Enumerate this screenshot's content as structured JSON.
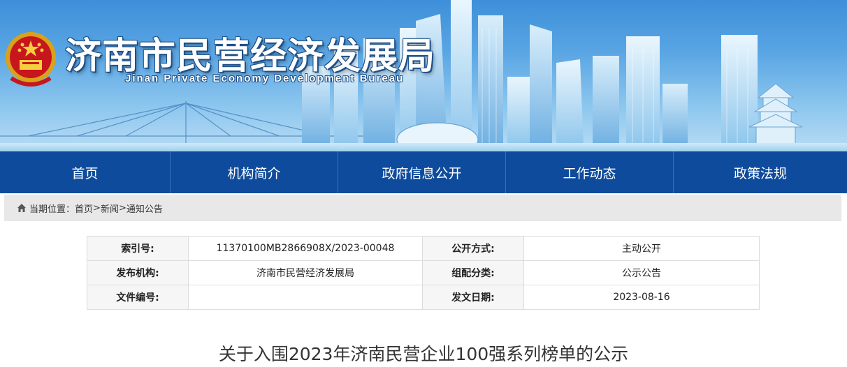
{
  "header": {
    "title": "济南市民营经济发展局",
    "subtitle": "Jinan Private Economy Development Bureau",
    "emblem_icon": "national-emblem-icon"
  },
  "nav": {
    "items": [
      {
        "label": "首页"
      },
      {
        "label": "机构简介"
      },
      {
        "label": "政府信息公开"
      },
      {
        "label": "工作动态"
      },
      {
        "label": "政策法规"
      }
    ]
  },
  "breadcrumb": {
    "prefix": "当期位置：",
    "items": [
      "首页",
      "新闻",
      "通知公告"
    ],
    "separator": ">",
    "icon": "home-icon"
  },
  "meta": {
    "index_label": "索引号:",
    "index_value": "11370100MB2866908X/2023-00048",
    "disclosure_label": "公开方式:",
    "disclosure_value": "主动公开",
    "publisher_label": "发布机构:",
    "publisher_value": "济南市民营经济发展局",
    "category_label": "组配分类:",
    "category_value": "公示公告",
    "docno_label": "文件编号:",
    "docno_value": "",
    "date_label": "发文日期:",
    "date_value": "2023-08-16"
  },
  "article": {
    "title": "关于入围2023年济南民营企业100强系列榜单的公示"
  },
  "colors": {
    "nav_bg": "#0f4b9c",
    "banner_top": "#3d8fd9",
    "banner_bottom": "#b9dcf4",
    "breadcrumb_bg": "#e8e8e8"
  }
}
